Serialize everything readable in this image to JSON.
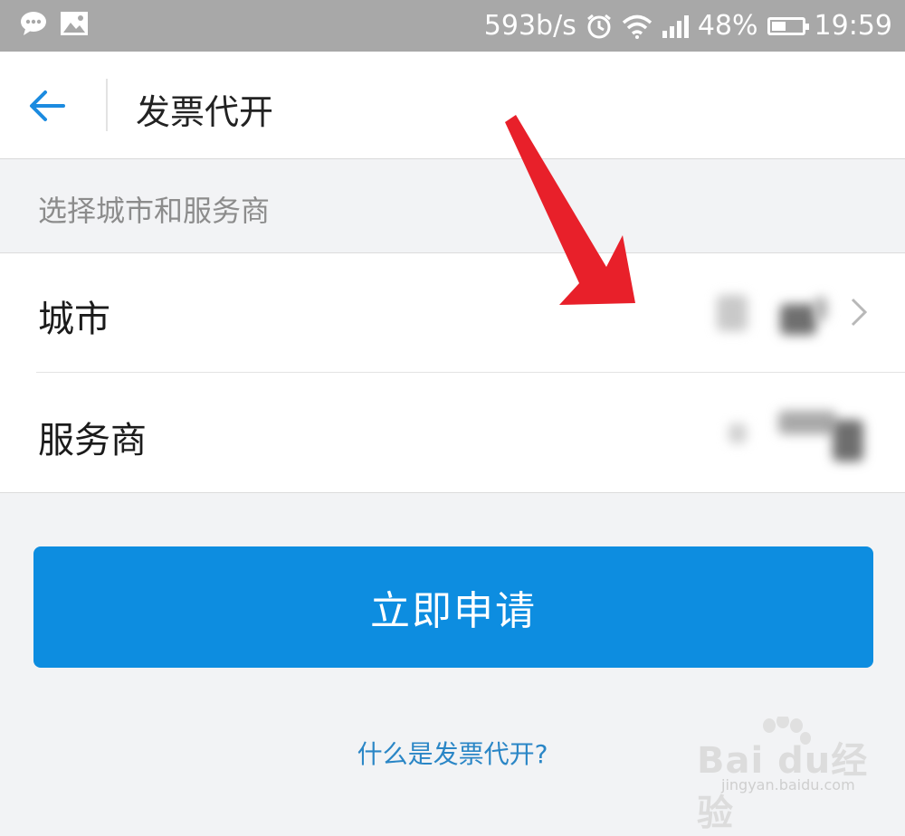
{
  "status_bar": {
    "speed": "593b/s",
    "battery": "48%",
    "battery_level": 0.48,
    "time": "19:59",
    "icons": [
      "chat-icon",
      "image-icon",
      "alarm-icon",
      "wifi-icon",
      "signal-icon",
      "battery-icon"
    ]
  },
  "header": {
    "title": "发票代开",
    "back_icon": "arrow-left-icon"
  },
  "section": {
    "label": "选择城市和服务商"
  },
  "form": {
    "city_label": "城市",
    "provider_label": "服务商"
  },
  "actions": {
    "apply_label": "立即申请",
    "help_link": "什么是发票代开?"
  },
  "watermark": {
    "brand": "Bai  du经验",
    "url": "jingyan.baidu.com"
  },
  "colors": {
    "accent": "#0d8de0",
    "link": "#2a86c6",
    "annotation": "#e8202a",
    "status_bar": "#a8a8a8"
  }
}
